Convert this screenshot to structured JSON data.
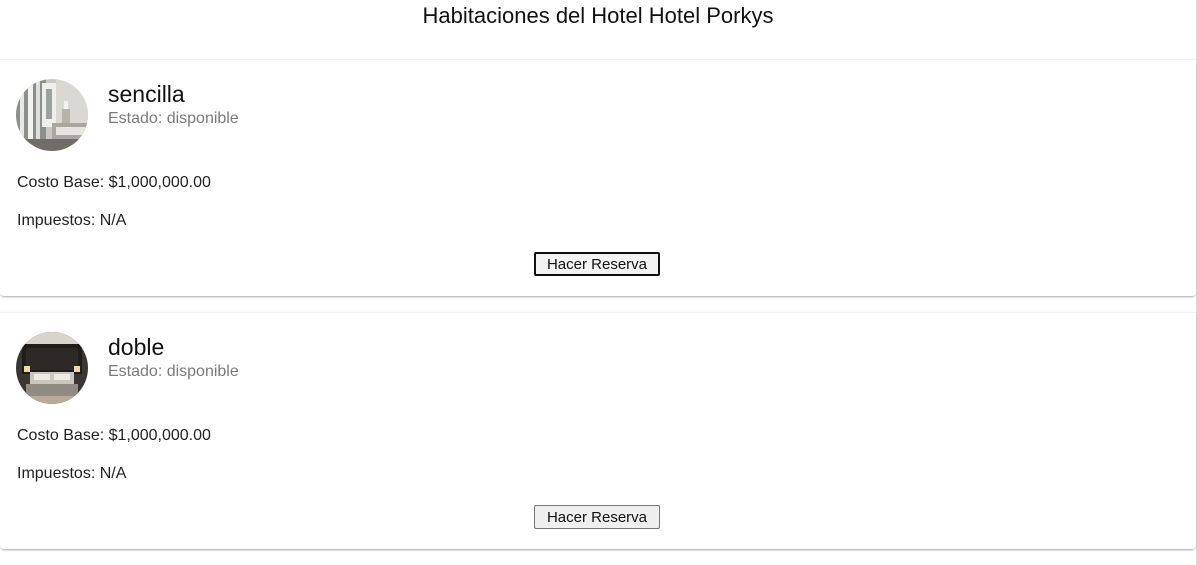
{
  "page": {
    "title": "Habitaciones del Hotel Hotel Porkys"
  },
  "rooms": [
    {
      "name": "sencilla",
      "status": "Estado: disponible",
      "cost": "Costo Base: $1,000,000.00",
      "taxes": "Impuestos: N/A",
      "button_label": "Hacer Reserva",
      "image_icon": "bedroom-photo-light"
    },
    {
      "name": "doble",
      "status": "Estado: disponible",
      "cost": "Costo Base: $1,000,000.00",
      "taxes": "Impuestos: N/A",
      "button_label": "Hacer Reserva",
      "image_icon": "bedroom-photo-dark"
    }
  ],
  "colors": {
    "title_text": "#111111",
    "status_text": "#7a7a7a",
    "body_text": "#222222",
    "button_bg": "#efefef"
  }
}
